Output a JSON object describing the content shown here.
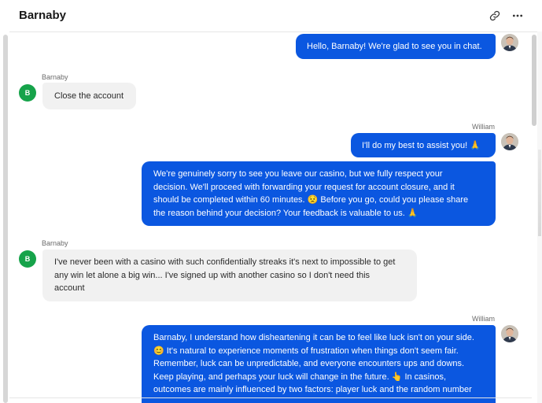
{
  "header": {
    "title": "Barnaby",
    "link_icon": "link-icon",
    "more_icon": "more-horizontal-icon"
  },
  "colors": {
    "agent_bubble": "#0b57e0",
    "customer_bubble": "#f1f1f1",
    "customer_avatar": "#16a34a"
  },
  "messages": [
    {
      "from": "William",
      "role": "agent",
      "text": "Hello, Barnaby! We're glad to see you in chat."
    },
    {
      "from": "Barnaby",
      "role": "customer",
      "avatar_initial": "B",
      "text": "Close the account"
    },
    {
      "from": "William",
      "role": "agent",
      "text": "I'll do my best to assist you! 🙏"
    },
    {
      "from": "William",
      "role": "agent",
      "lines": [
        "We're genuinely sorry to see you leave our casino, but we fully respect your",
        "decision. We'll proceed with forwarding your request for account closure, and it",
        "should be completed within 60 minutes. 😟 Before you go, could you please share",
        "the reason behind your decision? Your feedback is valuable to us. 🙏"
      ]
    },
    {
      "from": "Barnaby",
      "role": "customer",
      "avatar_initial": "B",
      "lines": [
        "I've never been with a casino with such confidentially streaks it's next to impossible to get",
        "any win let alone a big win... I've signed up with another casino so I don't need this",
        "account"
      ]
    },
    {
      "from": "William",
      "role": "agent",
      "lines": [
        "Barnaby, I understand how disheartening it can be to feel like luck isn't on your side.",
        "😊 It's natural to experience moments of frustration when things don't seem fair.",
        "Remember, luck can be unpredictable, and everyone encounters ups and downs.",
        "Keep playing, and perhaps your luck will change in the future. 👆 In casinos,",
        "outcomes are mainly influenced by two factors: player luck and the random number"
      ]
    }
  ]
}
